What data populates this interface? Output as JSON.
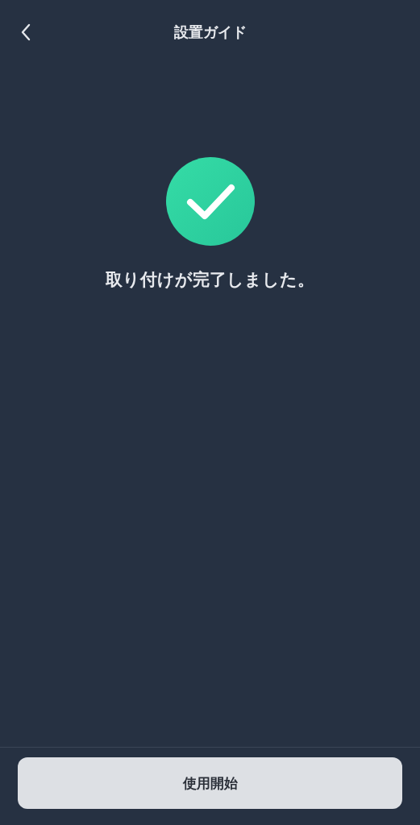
{
  "header": {
    "title": "設置ガイド"
  },
  "status": {
    "message": "取り付けが完了しました。"
  },
  "footer": {
    "button": "使用開始"
  }
}
